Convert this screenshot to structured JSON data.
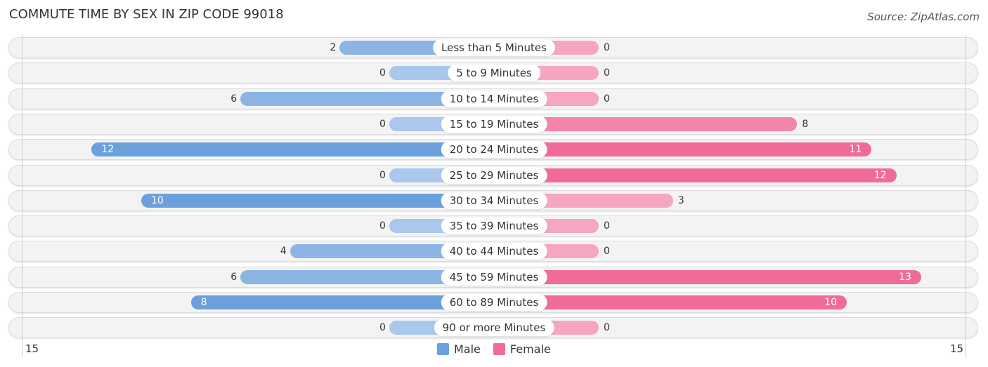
{
  "title": "COMMUTE TIME BY SEX IN ZIP CODE 99018",
  "source": "Source: ZipAtlas.com",
  "colors": {
    "male": "#6ba0dc",
    "female": "#f06c96",
    "male_light": "#a9c8ec",
    "female_light": "#f7a6c0"
  },
  "chart_data": {
    "type": "bar",
    "orientation": "horizontal-diverging",
    "title": "COMMUTE TIME BY SEX IN ZIP CODE 99018",
    "categories": [
      "Less than 5 Minutes",
      "5 to 9 Minutes",
      "10 to 14 Minutes",
      "15 to 19 Minutes",
      "20 to 24 Minutes",
      "25 to 29 Minutes",
      "30 to 34 Minutes",
      "35 to 39 Minutes",
      "40 to 44 Minutes",
      "45 to 59 Minutes",
      "60 to 89 Minutes",
      "90 or more Minutes"
    ],
    "series": [
      {
        "name": "Male",
        "values": [
          2,
          0,
          6,
          0,
          12,
          0,
          10,
          0,
          4,
          6,
          8,
          0
        ]
      },
      {
        "name": "Female",
        "values": [
          0,
          0,
          0,
          8,
          11,
          12,
          3,
          0,
          0,
          13,
          10,
          0
        ]
      }
    ],
    "axis": {
      "left_label": "15",
      "right_label": "15",
      "range": [
        0,
        15
      ]
    },
    "legend": {
      "position": "bottom-center",
      "items": [
        "Male",
        "Female"
      ]
    }
  }
}
